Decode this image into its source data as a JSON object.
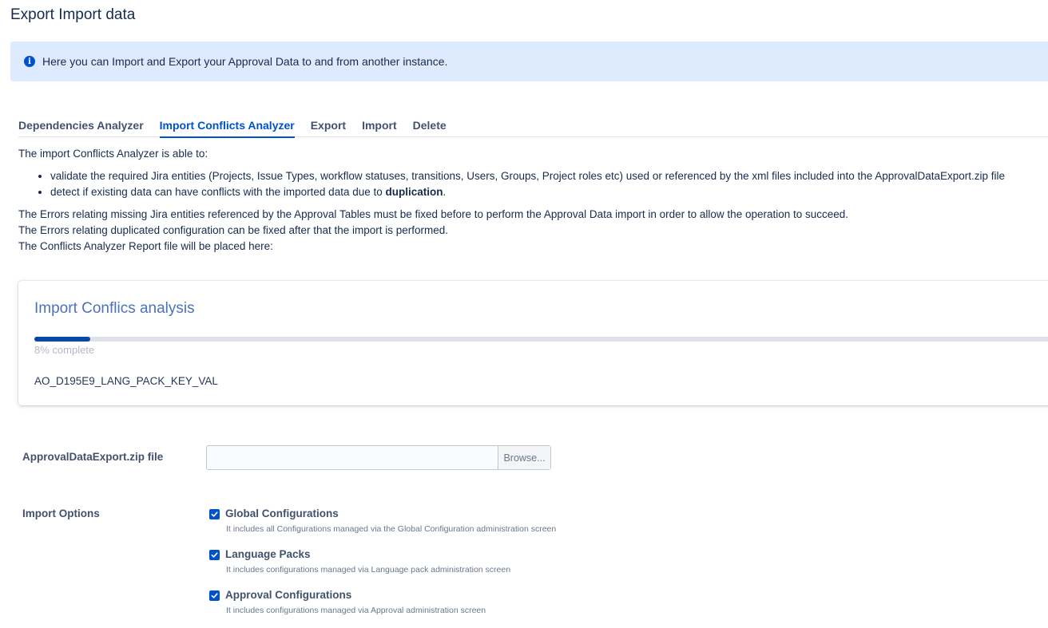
{
  "page": {
    "title": "Export Import data"
  },
  "banner": {
    "icon": "info-icon",
    "text": "Here you can Import and Export your Approval Data to and from another instance."
  },
  "tabs": [
    {
      "label": "Dependencies Analyzer",
      "active": false
    },
    {
      "label": "Import Conflicts Analyzer",
      "active": true
    },
    {
      "label": "Export",
      "active": false
    },
    {
      "label": "Import",
      "active": false
    },
    {
      "label": "Delete",
      "active": false
    }
  ],
  "description": {
    "intro": "The import Conflicts Analyzer is able to:",
    "bullet1": "validate the required Jira entities (Projects, Issue Types, workflow statuses, transitions, Users, Groups, Project roles etc) used or referenced by the xml files included into the ApprovalDataExport.zip file",
    "bullet2_prefix": "detect if existing data can have conflicts with the imported data due to ",
    "bullet2_bold": "duplication",
    "bullet2_suffix": ".",
    "line1": "The Errors relating missing Jira entities referenced by the Approval Tables must be fixed before to perform the Approval Data import in order to allow the operation to succeed.",
    "line2": "The Errors relating duplicated configuration can be fixed after that the import is performed.",
    "line3": "The Conflicts Analyzer Report file will be placed here:"
  },
  "analysis": {
    "title": "Import Conflics analysis",
    "progress_percent": 8,
    "progress_text": "8% complete",
    "current_table": "AO_D195E9_LANG_PACK_KEY_VAL"
  },
  "file_field": {
    "label": "ApprovalDataExport.zip file",
    "value": "",
    "browse_label": "Browse..."
  },
  "import_options": {
    "label": "Import Options",
    "items": [
      {
        "label": "Global Configurations",
        "description": "It includes all Configurations managed via the Global Configuration administration screen",
        "checked": true
      },
      {
        "label": "Language Packs",
        "description": "It includes configurations managed via Language pack administration screen",
        "checked": true
      },
      {
        "label": "Approval Configurations",
        "description": "It includes configurations managed via Approval administration screen",
        "checked": true
      }
    ]
  },
  "colors": {
    "accent": "#0052cc",
    "banner_bg": "#deebff",
    "progress_fill": "#0747a6",
    "card_title": "#4a72c0"
  }
}
